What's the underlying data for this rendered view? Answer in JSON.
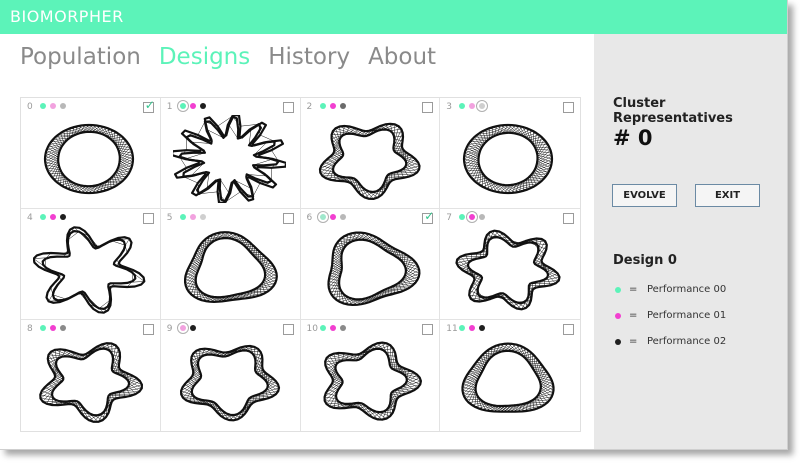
{
  "app": {
    "title": "BIOMORPHER"
  },
  "nav": {
    "tabs": [
      "Population",
      "Designs",
      "History",
      "About"
    ],
    "active": "Designs"
  },
  "colors": {
    "accent": "#5cf3b9",
    "perf0": "#5cf3b9",
    "perf1": "#f23fd0",
    "perf2": "#1f1f1f",
    "check": "#33c58e"
  },
  "sidebar": {
    "heading": "Cluster Representatives",
    "cluster_number": "# 0",
    "evolve_label": "EVOLVE",
    "exit_label": "EXIT",
    "design_title": "Design 0",
    "legend": [
      {
        "marker": "=",
        "label": "Performance 00",
        "color": "#5cf3b9"
      },
      {
        "marker": "=",
        "label": "Performance 01",
        "color": "#f23fd0"
      },
      {
        "marker": "=",
        "label": "Performance 02",
        "color": "#1f1f1f"
      }
    ]
  },
  "designs": [
    {
      "index": "0",
      "checked": true,
      "dots": [
        "#5cf3b9",
        "#f2a2df",
        "#b8b8b8"
      ],
      "selected_dot": -1
    },
    {
      "index": "1",
      "checked": false,
      "dots": [
        "#5cf3b9",
        "#f23fd0",
        "#1f1f1f"
      ],
      "selected_dot": 0
    },
    {
      "index": "2",
      "checked": false,
      "dots": [
        "#5cf3b9",
        "#f23fd0",
        "#6b6b6b"
      ],
      "selected_dot": -1
    },
    {
      "index": "3",
      "checked": false,
      "dots": [
        "#5cf3b9",
        "#f2a2df",
        "#cfcfcf"
      ],
      "selected_dot": 2
    },
    {
      "index": "4",
      "checked": false,
      "dots": [
        "#5cf3b9",
        "#f23fd0",
        "#1f1f1f"
      ],
      "selected_dot": -1
    },
    {
      "index": "5",
      "checked": false,
      "dots": [
        "#5cf3b9",
        "#f2a2df",
        "#cfcfcf"
      ],
      "selected_dot": -1
    },
    {
      "index": "6",
      "checked": true,
      "dots": [
        "#9fe8cc",
        "#f23fd0",
        "#b8b8b8"
      ],
      "selected_dot": 0
    },
    {
      "index": "7",
      "checked": false,
      "dots": [
        "#5cf3b9",
        "#f23fd0",
        "#b8b8b8"
      ],
      "selected_dot": 1
    },
    {
      "index": "8",
      "checked": false,
      "dots": [
        "#5cf3b9",
        "#f23fd0",
        "#8a8a8a"
      ],
      "selected_dot": -1
    },
    {
      "index": "9",
      "checked": false,
      "dots": [
        "#f2a2df",
        "#1f1f1f"
      ],
      "selected_dot": 0
    },
    {
      "index": "10",
      "checked": false,
      "dots": [
        "#5cf3b9",
        "#f23fd0",
        "#8a8a8a"
      ],
      "selected_dot": -1
    },
    {
      "index": "11",
      "checked": false,
      "dots": [
        "#5cf3b9",
        "#f23fd0",
        "#1f1f1f"
      ],
      "selected_dot": -1
    }
  ]
}
